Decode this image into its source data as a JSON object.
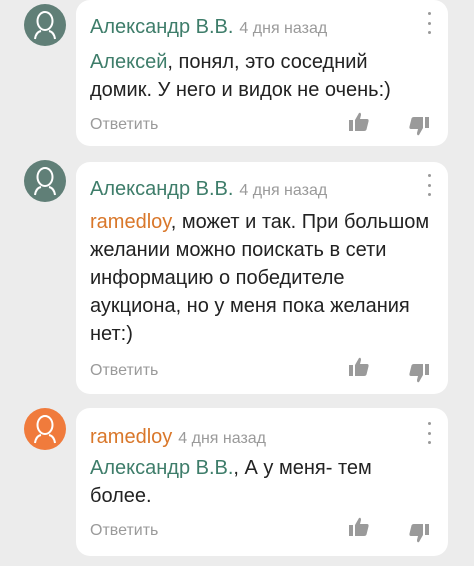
{
  "comments": [
    {
      "author": "Александр В.В.",
      "time": "4 дня назад",
      "mention": "Алексей",
      "text": ", понял, это соседний домик. У него и видок не очень:)",
      "reply_label": "Ответить",
      "avatar_color": "#607f77",
      "author_color": "#3e7d6a",
      "mention_color": "#3e7d6a"
    },
    {
      "author": "Александр В.В.",
      "time": "4 дня назад",
      "mention": "ramedloy",
      "text": ", может и так. При большом желании можно поискать в сети информацию о победителе аукциона, но у меня пока желания нет:)",
      "reply_label": "Ответить",
      "avatar_color": "#607f77",
      "author_color": "#3e7d6a",
      "mention_color": "#d9772a"
    },
    {
      "author": "ramedloy",
      "time": "4 дня назад",
      "mention": "Александр В.В.",
      "text": ", А у меня- тем более.",
      "reply_label": "Ответить",
      "avatar_color": "#f07b3c",
      "author_color": "#d9772a",
      "mention_color": "#3e7d6a"
    }
  ],
  "icons": {
    "avatar": "user-silhouette-icon",
    "menu": "more-vertical-icon",
    "like": "thumbs-up-icon",
    "dislike": "thumbs-down-icon"
  }
}
